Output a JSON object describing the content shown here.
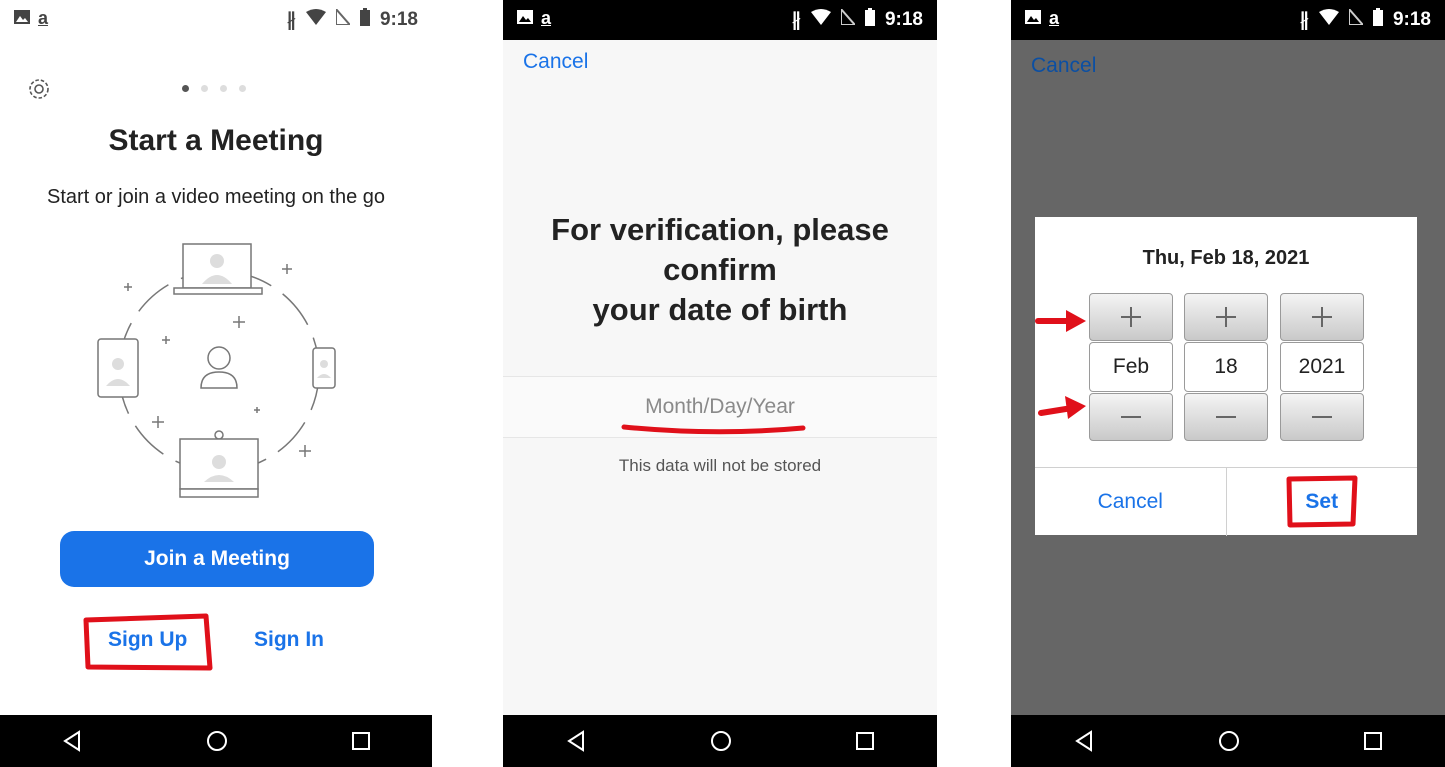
{
  "status_bar": {
    "time": "9:18",
    "left_letter": "a",
    "icons": [
      "image-icon",
      "amazon-icon",
      "bluetooth-icon",
      "wifi-icon",
      "no-sim-icon",
      "battery-icon"
    ]
  },
  "screen1": {
    "title": "Start a Meeting",
    "subtitle": "Start or join a video meeting on the go",
    "join_button": "Join a Meeting",
    "sign_up": "Sign Up",
    "sign_in": "Sign In",
    "page_indicator": {
      "count": 4,
      "active": 1
    }
  },
  "screen2": {
    "cancel": "Cancel",
    "heading": "For verification, please\nconfirm\nyour date of birth",
    "date_placeholder": "Month/Day/Year",
    "note": "This data will not be stored"
  },
  "screen3": {
    "cancel": "Cancel",
    "dialog_title": "Thu, Feb 18, 2021",
    "month": "Feb",
    "day": "18",
    "year": "2021",
    "cancel_button": "Cancel",
    "set_button": "Set"
  },
  "colors": {
    "accent": "#1a73e8",
    "annotation_red": "#e0101a",
    "dim_background": "#666666"
  }
}
